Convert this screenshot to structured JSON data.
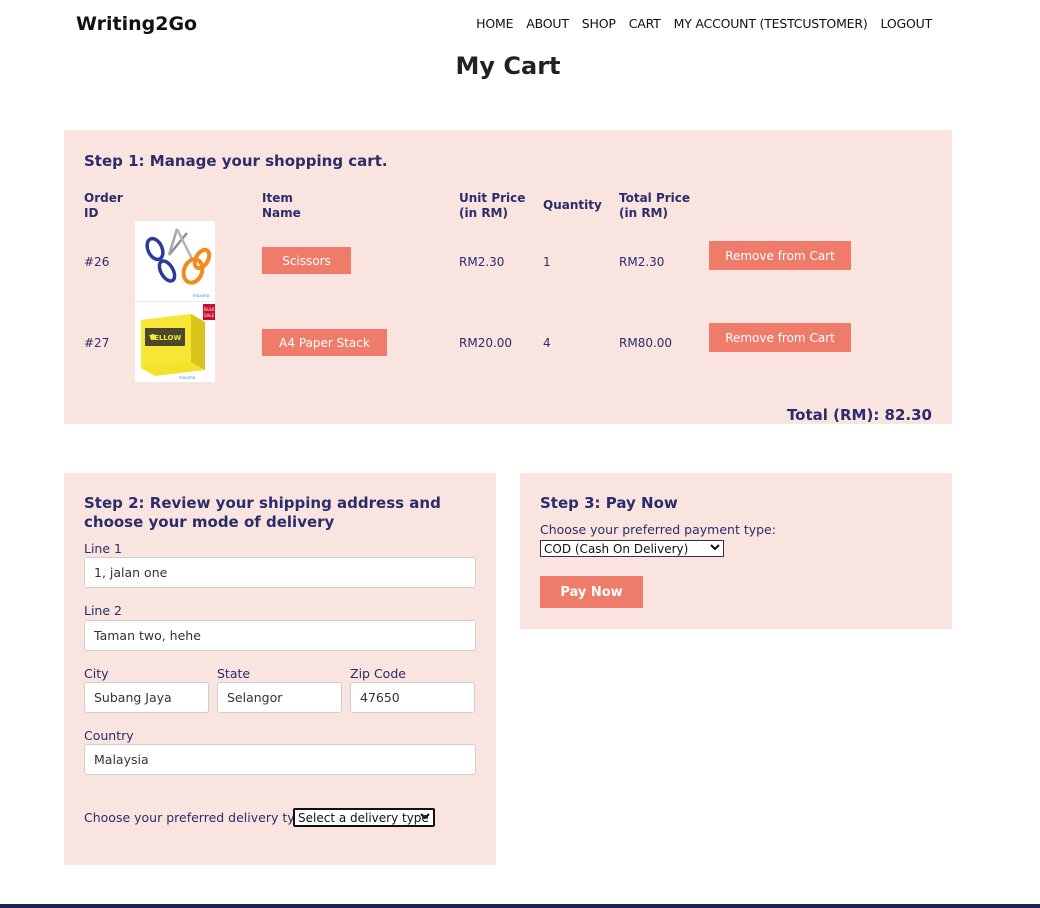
{
  "brand": "Writing2Go",
  "nav": [
    "HOME",
    "ABOUT",
    "SHOP",
    "CART",
    "MY ACCOUNT (TESTCUSTOMER)",
    "LOGOUT"
  ],
  "page_title": "My Cart",
  "step1": {
    "title": "Step 1: Manage your shopping cart.",
    "headers": {
      "order_id": [
        "Order",
        "ID"
      ],
      "item_name": [
        "Item",
        "Name"
      ],
      "unit_price": [
        "Unit Price",
        "(in RM)"
      ],
      "quantity": "Quantity",
      "total_price": [
        "Total Price",
        "(in RM)"
      ]
    },
    "rows": [
      {
        "order_id": "#26",
        "item_name": "Scissors",
        "image": "scissors-image",
        "unit_price": "RM2.30",
        "quantity": "1",
        "total_price": "RM2.30",
        "remove_label": "Remove from Cart"
      },
      {
        "order_id": "#27",
        "item_name": "A4 Paper Stack",
        "image": "paper-stack-image",
        "unit_price": "RM20.00",
        "quantity": "4",
        "total_price": "RM80.00",
        "remove_label": "Remove from Cart"
      }
    ],
    "total": "Total (RM): 82.30"
  },
  "step2": {
    "title": "Step 2: Review your shipping address and choose your mode of delivery",
    "line1_label": "Line 1",
    "line1_value": "1, jalan one",
    "line2_label": "Line 2",
    "line2_value": "Taman two, hehe",
    "city_label": "City",
    "city_value": "Subang Jaya",
    "state_label": "State",
    "state_value": "Selangor",
    "zip_label": "Zip Code",
    "zip_value": "47650",
    "country_label": "Country",
    "country_value": "Malaysia",
    "delivery_label": "Choose your preferred delivery type:",
    "delivery_selected": "Select a delivery type"
  },
  "step3": {
    "title": "Step 3: Pay Now",
    "payment_label": "Choose your preferred payment type:",
    "payment_selected": "COD (Cash On Delivery)",
    "pay_button": "Pay Now"
  },
  "colors": {
    "panel_bg": "#f9e4df",
    "accent": "#ef7c6a",
    "heading": "#2b2c6b",
    "footer": "#1e2452"
  }
}
